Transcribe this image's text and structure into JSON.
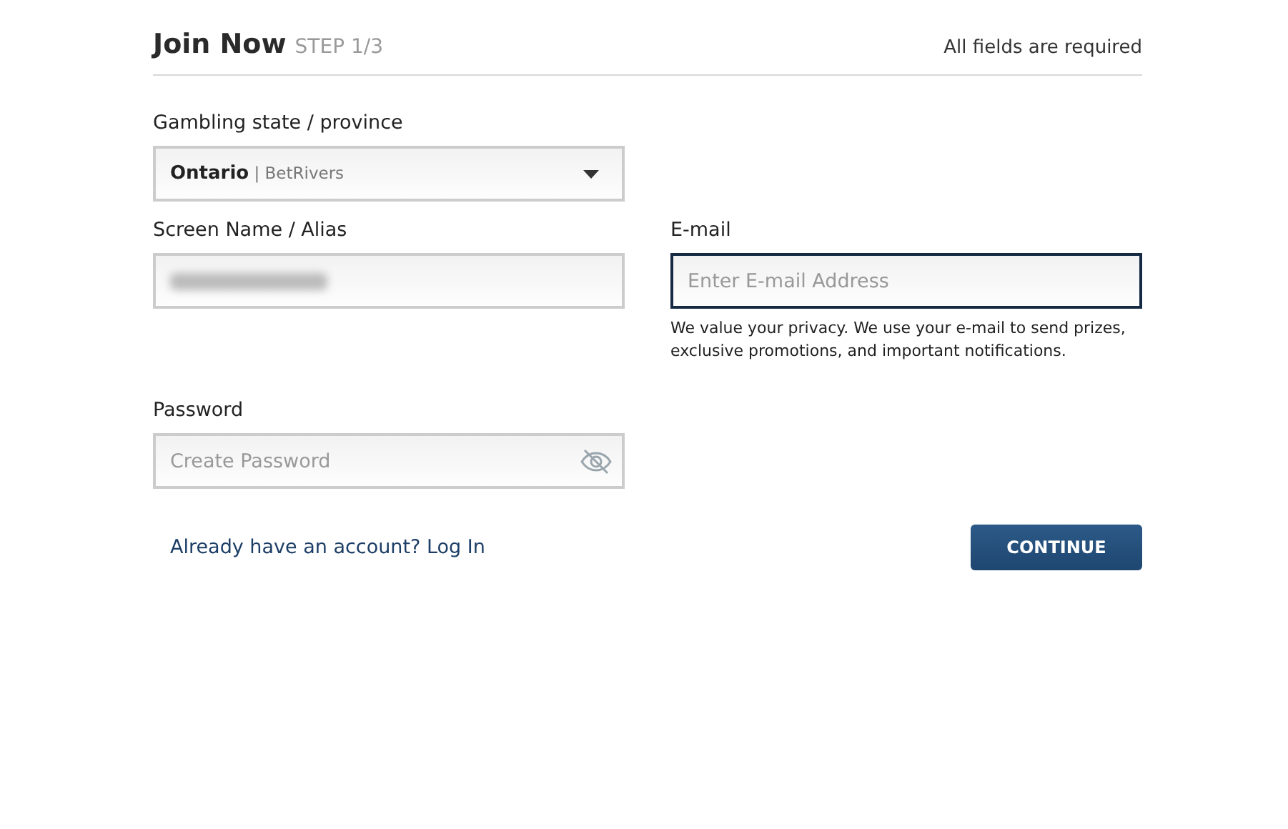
{
  "header": {
    "title": "Join Now",
    "step": "STEP 1/3",
    "note": "All fields are required"
  },
  "state_field": {
    "label": "Gambling state / province",
    "value": "Ontario",
    "operator": "| BetRivers"
  },
  "screen_name": {
    "label": "Screen Name / Alias",
    "redacted": true
  },
  "email": {
    "label": "E-mail",
    "placeholder": "Enter E-mail Address",
    "focused": true,
    "help": "We value your privacy. We use your e-mail to send prizes, exclusive promotions, and important notifications."
  },
  "password": {
    "label": "Password",
    "placeholder": "Create Password"
  },
  "login_link": "Already have an account? Log In",
  "continue_button": "CONTINUE"
}
